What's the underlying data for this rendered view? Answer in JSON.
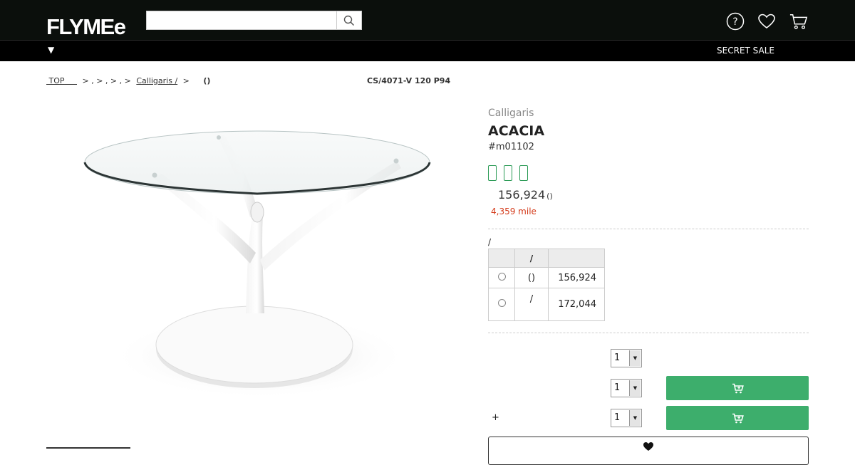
{
  "header": {
    "logo": "FLYMEe",
    "search": {
      "value": "",
      "placeholder": ""
    },
    "icons": [
      "help-icon",
      "heart-icon",
      "cart-icon"
    ]
  },
  "nav": {
    "toggle": "▼",
    "secret_sale": "SECRET SALE"
  },
  "breadcrumb": {
    "top": "TOP",
    "separators": "> , > , > , >",
    "brand_link": "Calligaris /",
    "last_sep": ">",
    "current": "()"
  },
  "product": {
    "code": "CS/4071-V 120 P94",
    "brand": "Calligaris",
    "name": "ACACIA",
    "sku": "#m01102",
    "price": "156,924",
    "price_tax": "()",
    "mile": "4,359 mile",
    "badge_color": "#2a9a55"
  },
  "options": {
    "label": "/",
    "headers": [
      "",
      "/",
      ""
    ],
    "rows": [
      {
        "name": "()",
        "price": "156,924"
      },
      {
        "name": "/",
        "price": "172,044"
      }
    ]
  },
  "purchase": {
    "rows": [
      {
        "label": "",
        "qty": "1"
      },
      {
        "label": "",
        "qty": "1"
      },
      {
        "label": "+",
        "qty": "1"
      }
    ],
    "button_color": "#3dae6c"
  }
}
